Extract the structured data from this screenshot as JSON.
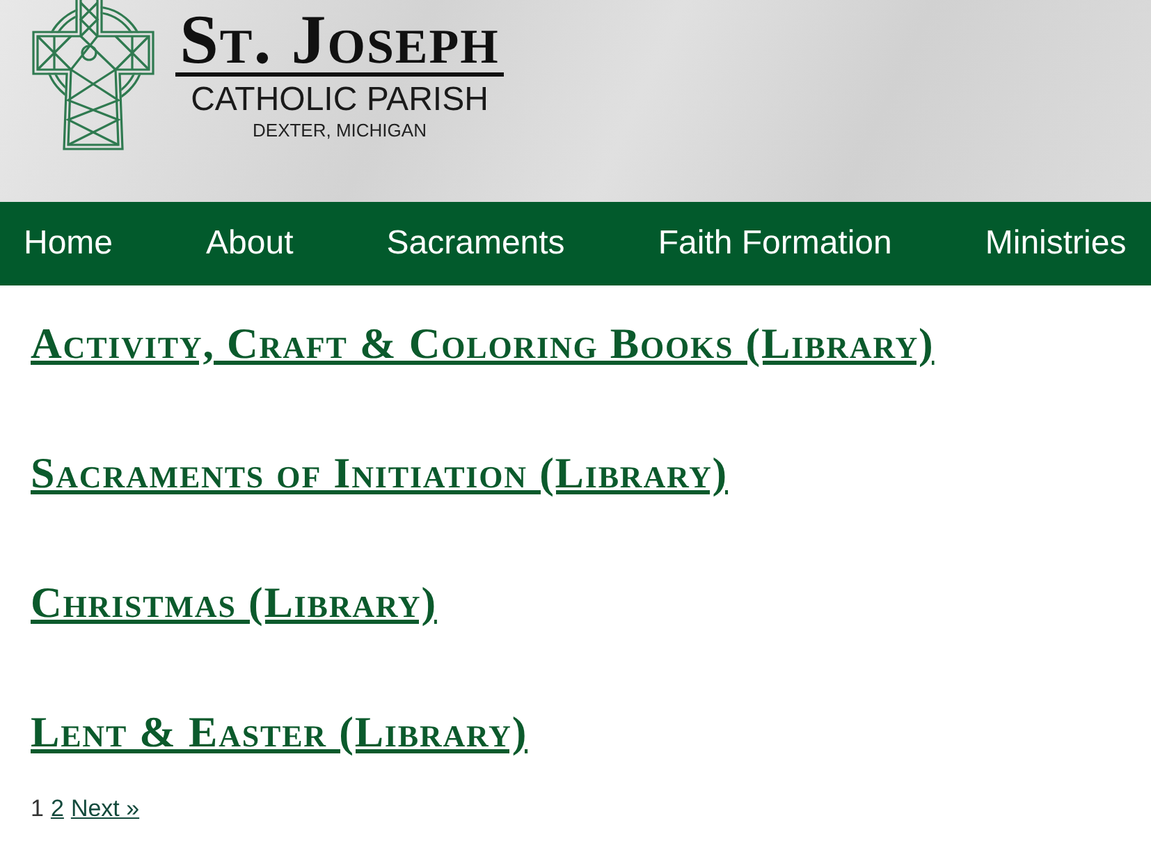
{
  "header": {
    "name": "St. Joseph",
    "subtitle": "CATHOLIC PARISH",
    "location": "DEXTER, MICHIGAN"
  },
  "navigation": [
    "Home",
    "About",
    "Sacraments",
    "Faith Formation",
    "Ministries"
  ],
  "posts": [
    "Activity, Craft & Coloring Books (Library)",
    "Sacraments of Initiation (Library)",
    "Christmas (Library)",
    "Lent & Easter (Library)"
  ],
  "pagination": {
    "pages": [
      {
        "label": "1",
        "selected": true
      },
      {
        "label": "2",
        "selected": false
      }
    ],
    "next": "Next »"
  }
}
